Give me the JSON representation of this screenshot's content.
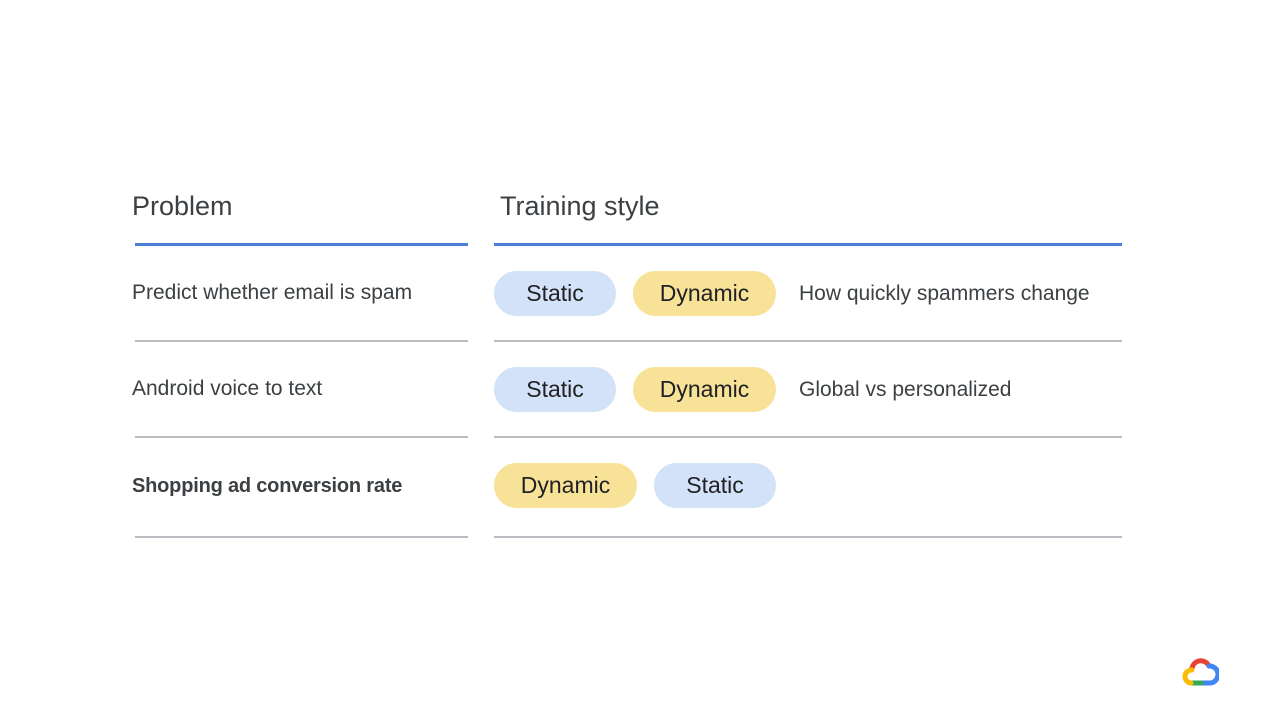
{
  "headers": {
    "problem": "Problem",
    "training_style": "Training style"
  },
  "rows": [
    {
      "problem": "Predict whether email is spam",
      "chips": [
        {
          "label": "Static",
          "type": "static"
        },
        {
          "label": "Dynamic",
          "type": "dynamic"
        }
      ],
      "note": "How quickly spammers change"
    },
    {
      "problem": "Android voice to text",
      "chips": [
        {
          "label": "Static",
          "type": "static"
        },
        {
          "label": "Dynamic",
          "type": "dynamic"
        }
      ],
      "note": "Global vs personalized"
    },
    {
      "problem": "Shopping ad conversion rate",
      "chips": [
        {
          "label": "Dynamic",
          "type": "dynamic"
        },
        {
          "label": "Static",
          "type": "static"
        }
      ],
      "note": ""
    }
  ],
  "colors": {
    "header_rule": "#4a7fd4",
    "row_rule": "#b8bcc0",
    "static_chip": "#d3e2f8",
    "dynamic_chip": "#f8e298"
  },
  "logo": {
    "icon": "google-cloud-logo-icon"
  }
}
